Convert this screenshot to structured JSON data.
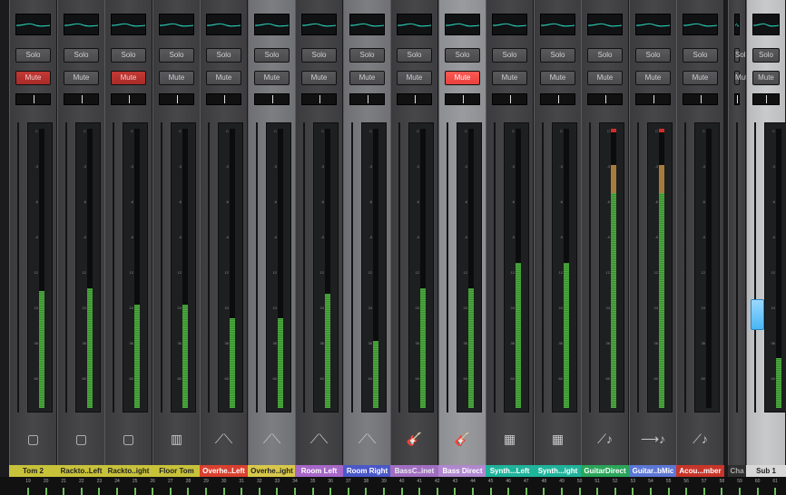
{
  "buttons": {
    "solo": "Solo",
    "mute": "Mute"
  },
  "channels": [
    {
      "name": "Tom 2",
      "label_color": "#c8c23a",
      "label_text_color": "#222",
      "mute_active": true,
      "meter_level": 0.42,
      "icon": "drum-pad-icon",
      "state": "normal"
    },
    {
      "name": "Rackto..Left",
      "label_color": "#c8c23a",
      "label_text_color": "#222",
      "mute_active": false,
      "meter_level": 0.43,
      "icon": "drum-pad-icon",
      "state": "normal"
    },
    {
      "name": "Rackto..ight",
      "label_color": "#c8c23a",
      "label_text_color": "#222",
      "mute_active": true,
      "meter_level": 0.37,
      "icon": "drum-pad-icon",
      "state": "normal"
    },
    {
      "name": "Floor Tom",
      "label_color": "#c8c23a",
      "label_text_color": "#222",
      "mute_active": false,
      "meter_level": 0.37,
      "icon": "floor-tom-icon",
      "state": "normal"
    },
    {
      "name": "Overhe..Left",
      "label_color": "#d9402f",
      "label_text_color": "#fff",
      "mute_active": false,
      "meter_level": 0.32,
      "icon": "overhead-mics-icon",
      "state": "normal"
    },
    {
      "name": "Overhe..ight",
      "label_color": "#d8c84a",
      "label_text_color": "#222",
      "mute_active": false,
      "meter_level": 0.32,
      "icon": "overhead-mics-icon",
      "state": "selected"
    },
    {
      "name": "Room Left",
      "label_color": "#a667c7",
      "label_text_color": "#fff",
      "mute_active": false,
      "meter_level": 0.41,
      "icon": "room-mics-icon",
      "state": "normal"
    },
    {
      "name": "Room Right",
      "label_color": "#4a58c8",
      "label_text_color": "#fff",
      "mute_active": false,
      "meter_level": 0.24,
      "icon": "room-mics-icon",
      "state": "selected"
    },
    {
      "name": "BassC..inet",
      "label_color": "#9f6dc0",
      "label_text_color": "#eee",
      "mute_active": false,
      "meter_level": 0.43,
      "icon": "bass-guitar-icon",
      "state": "normal"
    },
    {
      "name": "Bass Direct",
      "label_color": "#b087cf",
      "label_text_color": "#fff",
      "mute_active": true,
      "meter_level": 0.43,
      "icon": "bass-guitar-icon",
      "state": "selected-strong",
      "mute_bright": true
    },
    {
      "name": "Synth...Left",
      "label_color": "#1fb39b",
      "label_text_color": "#fff",
      "mute_active": false,
      "meter_level": 0.52,
      "icon": "keyboard-icon",
      "state": "normal"
    },
    {
      "name": "Synth...ight",
      "label_color": "#1fb39b",
      "label_text_color": "#fff",
      "mute_active": false,
      "meter_level": 0.52,
      "icon": "keyboard-icon",
      "state": "normal"
    },
    {
      "name": "GuitarDirect",
      "label_color": "#2aa55a",
      "label_text_color": "#fff",
      "mute_active": false,
      "meter_level": 0.77,
      "icon": "acoustic-guitar-icon",
      "state": "normal",
      "hot": true
    },
    {
      "name": "Guitar..bMic",
      "label_color": "#5b76d6",
      "label_text_color": "#fff",
      "mute_active": false,
      "meter_level": 0.77,
      "icon": "electric-guitar-icon",
      "state": "normal",
      "hot": true
    },
    {
      "name": "Acou...mber",
      "label_color": "#c8352a",
      "label_text_color": "#fff",
      "mute_active": false,
      "meter_level": 0.0,
      "icon": "acoustic-guitar-icon",
      "state": "normal"
    },
    {
      "name": "Cha",
      "label_color": "#2f2f2f",
      "label_text_color": "#aaa",
      "mute_active": false,
      "meter_level": 0.0,
      "icon": "none",
      "state": "narrow"
    },
    {
      "name": "Sub 1",
      "label_color": "#d8d8d8",
      "label_text_color": "#222",
      "mute_active": false,
      "meter_level": 0.18,
      "icon": "none",
      "state": "sub"
    }
  ],
  "scale_marks": [
    "C",
    "-3",
    "-6",
    "-9",
    "12",
    "24",
    "36",
    "60"
  ],
  "routing_numbers": [
    "19",
    "20",
    "21",
    "22",
    "23",
    "24",
    "25",
    "26",
    "27",
    "28",
    "29",
    "30",
    "31",
    "32",
    "33",
    "34",
    "35",
    "36",
    "37",
    "38",
    "39",
    "40",
    "41",
    "42",
    "43",
    "44",
    "45",
    "46",
    "47",
    "48",
    "49",
    "50",
    "51",
    "52",
    "53",
    "54",
    "55",
    "56",
    "57",
    "58",
    "59",
    "60",
    "61"
  ],
  "colors": {
    "mute_on": "#b7302c",
    "mute_on_bright": "#ff5a55",
    "meter_green": "#4caf3e",
    "fader_cap": "#48b6f5"
  }
}
